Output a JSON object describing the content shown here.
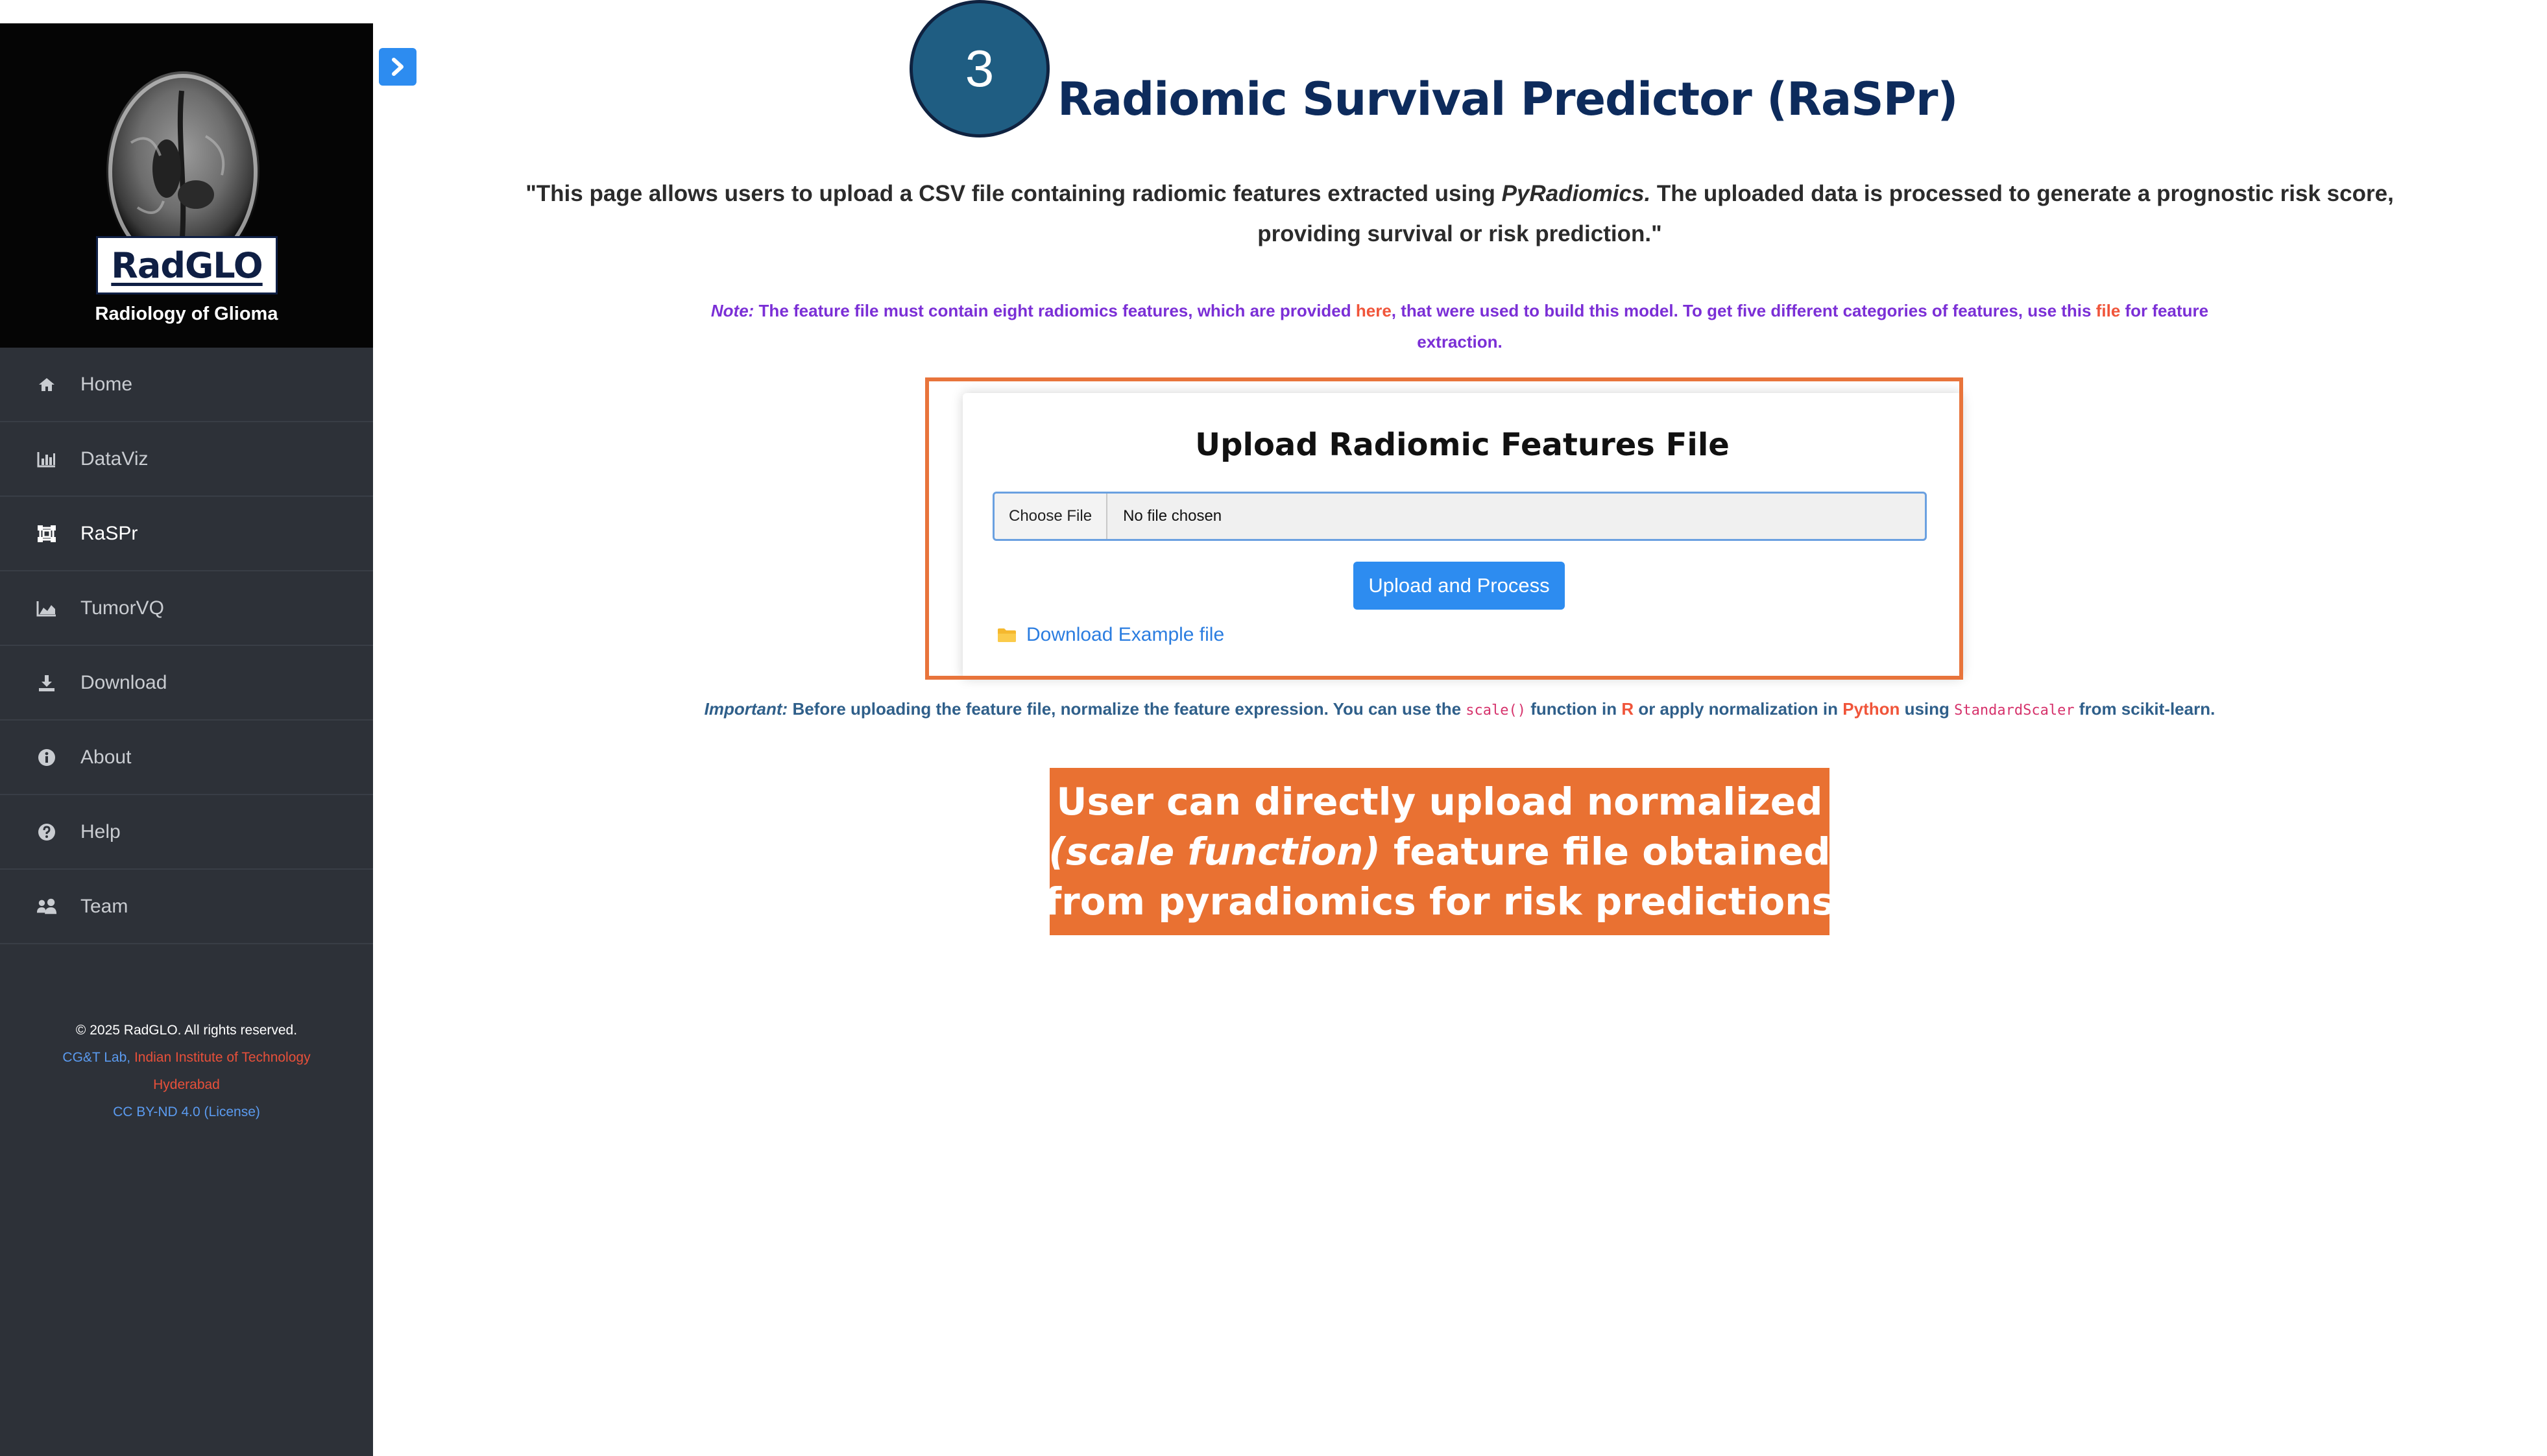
{
  "brand": {
    "logo_text": "RadGLO",
    "subtitle": "Radiology of Glioma"
  },
  "nav": {
    "items": [
      {
        "label": "Home",
        "icon": "home-icon"
      },
      {
        "label": "DataViz",
        "icon": "bar-chart-icon"
      },
      {
        "label": "RaSPr",
        "icon": "network-icon",
        "active": true
      },
      {
        "label": "TumorVQ",
        "icon": "area-chart-icon"
      },
      {
        "label": "Download",
        "icon": "download-icon"
      },
      {
        "label": "About",
        "icon": "info-icon"
      },
      {
        "label": "Help",
        "icon": "question-icon"
      },
      {
        "label": "Team",
        "icon": "users-icon"
      }
    ]
  },
  "footer": {
    "copyright": "© 2025 RadGLO. All rights reserved.",
    "lab": "CG&T Lab,",
    "institute": "Indian Institute of Technology",
    "city": "Hyderabad",
    "license": "CC BY-ND 4.0 (License)"
  },
  "header": {
    "step_number": "3",
    "title": "Radiomic Survival Predictor (RaSPr)"
  },
  "intro": {
    "part1": "\"This page allows users to upload a CSV file containing radiomic features extracted using ",
    "tool": "PyRadiomics.",
    "part2": " The uploaded data is processed to generate a prognostic risk score, providing survival or risk prediction.\""
  },
  "note": {
    "label": "Note:",
    "part1": " The feature file must contain eight radiomics features, which are provided ",
    "link1": "here",
    "part2": ", that were used to build this model. To get five different categories of features, use this ",
    "link2": "file",
    "part3": " for feature extraction."
  },
  "upload": {
    "title": "Upload Radiomic Features File",
    "choose_button": "Choose File",
    "file_status": "No file chosen",
    "submit_button": "Upload and Process",
    "example_link": "Download Example file"
  },
  "important": {
    "label": "Important:",
    "part1": " Before uploading the feature file, normalize the feature expression. You can use the ",
    "code1": "scale()",
    "part2": " function in ",
    "lang1": "R",
    "part3": " or apply normalization in ",
    "lang2": "Python",
    "part4": " using ",
    "code2": "StandardScaler",
    "part5": " from scikit-learn."
  },
  "callout": {
    "line1": "User can directly upload normalized",
    "line2_italic": "(scale function)",
    "line2_rest": " feature file obtained",
    "line3": "from pyradiomics for risk predictions"
  },
  "colors": {
    "sidebar_bg": "#2d3138",
    "accent_blue": "#2d8cf0",
    "title_navy": "#0d2b5c",
    "callout_orange": "#e97132",
    "note_purple": "#7b2fd6"
  }
}
